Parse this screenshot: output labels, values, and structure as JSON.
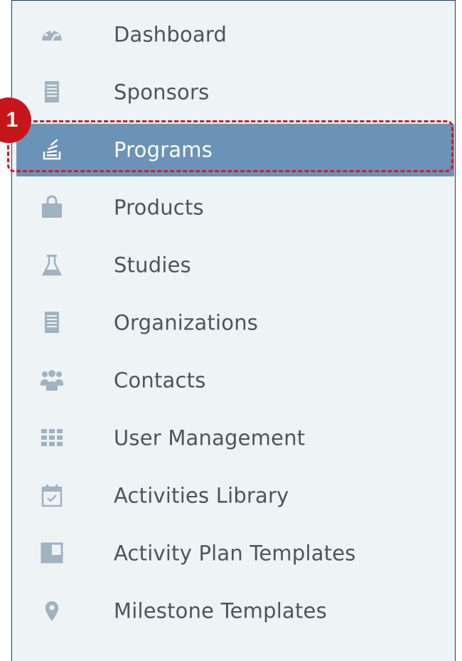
{
  "menu": {
    "items": [
      {
        "label": "Dashboard",
        "icon": "dashboard-gauge-icon",
        "active": false
      },
      {
        "label": "Sponsors",
        "icon": "document-icon",
        "active": false
      },
      {
        "label": "Programs",
        "icon": "stack-icon",
        "active": true
      },
      {
        "label": "Products",
        "icon": "shopping-bag-icon",
        "active": false
      },
      {
        "label": "Studies",
        "icon": "flask-icon",
        "active": false
      },
      {
        "label": "Organizations",
        "icon": "document-icon",
        "active": false
      },
      {
        "label": "Contacts",
        "icon": "users-icon",
        "active": false
      },
      {
        "label": "User Management",
        "icon": "grid-icon",
        "active": false
      },
      {
        "label": "Activities Library",
        "icon": "calendar-check-icon",
        "active": false
      },
      {
        "label": "Activity Plan Templates",
        "icon": "layout-icon",
        "active": false
      },
      {
        "label": "Milestone Templates",
        "icon": "map-pin-icon",
        "active": false
      }
    ]
  },
  "annotation": {
    "step_number": "1",
    "highlight_color": "#d8181e"
  },
  "colors": {
    "sidebar_bg": "#eef3f5",
    "active_bg": "#6a93b7",
    "icon_color": "#9fb3c2",
    "text_color": "#4a5560"
  }
}
